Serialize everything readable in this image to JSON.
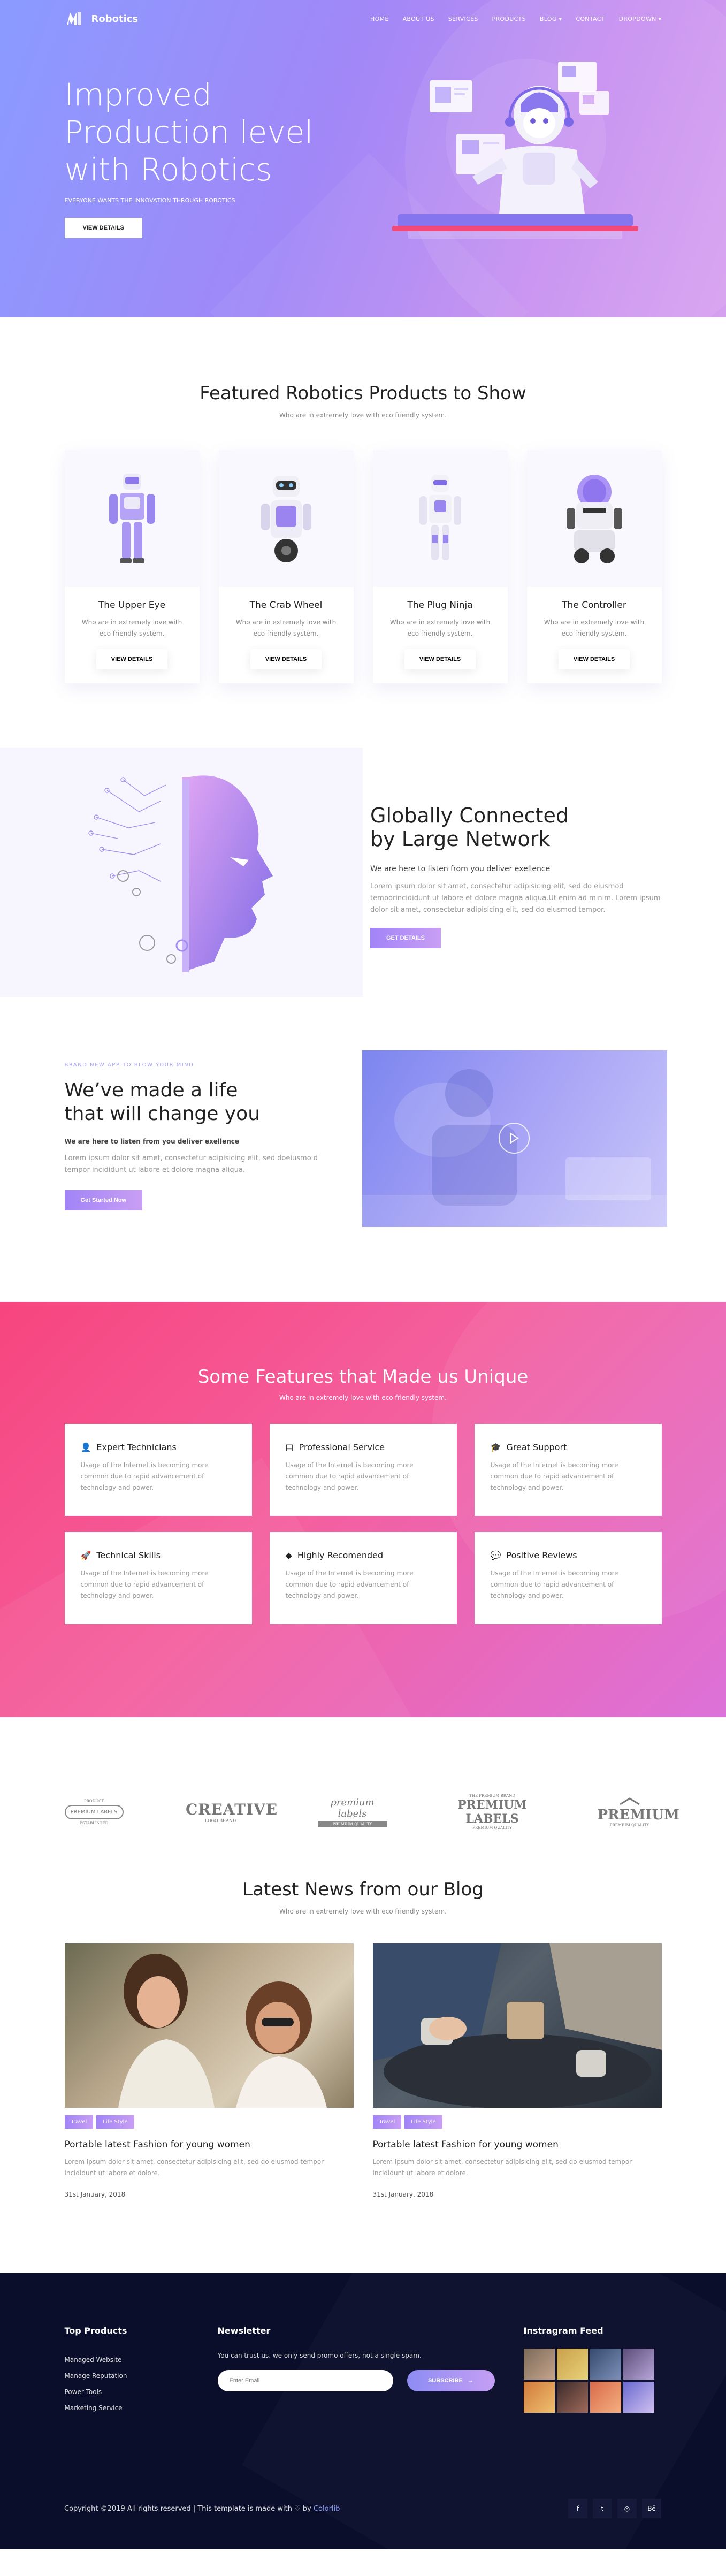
{
  "header": {
    "brand": "Robotics",
    "nav": [
      "HOME",
      "ABOUT US",
      "SERVICES",
      "PRODUCTS",
      "BLOG",
      "CONTACT",
      "DROPDOWN"
    ],
    "nav_dropdown_arrow": "▾"
  },
  "hero": {
    "title": "Improved Production level with Robotics",
    "subtitle": "EVERYONE WANTS THE INNOVATION THROUGH ROBOTICS",
    "button": "VIEW DETAILS"
  },
  "featured": {
    "title": "Featured Robotics Products to Show",
    "subtitle": "Who are in extremely love with eco friendly system.",
    "cards": [
      {
        "title": "The Upper Eye",
        "text": "Who are in extremely love with eco friendly system.",
        "button": "VIEW DETAILS",
        "icon": "humanoid-robot-icon"
      },
      {
        "title": "The Crab Wheel",
        "text": "Who are in extremely love with eco friendly system.",
        "button": "VIEW DETAILS",
        "icon": "wheel-robot-icon"
      },
      {
        "title": "The Plug Ninja",
        "text": "Who are in extremely love with eco friendly system.",
        "button": "VIEW DETAILS",
        "icon": "ninja-robot-icon"
      },
      {
        "title": "The Controller",
        "text": "Who are in extremely love with eco friendly system.",
        "button": "VIEW DETAILS",
        "icon": "dome-robot-icon"
      }
    ]
  },
  "network": {
    "title_line1": "Globally Connected",
    "title_line2": "by Large Network",
    "lead": "We are here to listen from you deliver exellence",
    "body": "Lorem ipsum dolor sit amet, consectetur adipisicing elit, sed do eiusmod temporincididunt ut labore et dolore magna aliqua.Ut enim ad minim. Lorem ipsum dolor sit amet, consectetur adipisicing elit, sed do eiusmod tempor.",
    "button": "GET DETAILS"
  },
  "life": {
    "kicker": "BRAND NEW APP TO BLOW YOUR MIND",
    "title_line1": "We’ve made a life",
    "title_line2": "that will change you",
    "lead": "We are here to listen from you deliver exellence",
    "body": "Lorem ipsum dolor sit amet, consectetur adipisicing elit, sed doeiusmo d tempor incididunt ut labore et dolore magna aliqua.",
    "button": "Get Started Now"
  },
  "features": {
    "title": "Some Features that Made us Unique",
    "subtitle": "Who are in extremely love with eco friendly system.",
    "items": [
      {
        "title": "Expert Technicians",
        "text": "Usage of the Internet is becoming more common due to rapid advancement of technology and power.",
        "icon": "user-icon"
      },
      {
        "title": "Professional Service",
        "text": "Usage of the Internet is becoming more common due to rapid advancement of technology and power.",
        "icon": "certificate-icon"
      },
      {
        "title": "Great Support",
        "text": "Usage of the Internet is becoming more common due to rapid advancement of technology and power.",
        "icon": "graduation-cap-icon"
      },
      {
        "title": "Technical Skills",
        "text": "Usage of the Internet is becoming more common due to rapid advancement of technology and power.",
        "icon": "rocket-icon"
      },
      {
        "title": "Highly Recomended",
        "text": "Usage of the Internet is becoming more common due to rapid advancement of technology and power.",
        "icon": "diamond-icon"
      },
      {
        "title": "Positive Reviews",
        "text": "Usage of the Internet is becoming more common due to rapid advancement of technology and power.",
        "icon": "chat-bubble-icon"
      }
    ]
  },
  "brands": [
    {
      "main": "PREMIUM LABELS",
      "top": "PRODUCT",
      "bottom": "ESTABLISHED"
    },
    {
      "main": "CREATIVE",
      "top": "",
      "bottom": "LOGO BRAND"
    },
    {
      "main": "premium labels",
      "top": "",
      "bottom": "PREMIUM QUALITY"
    },
    {
      "main": "PREMIUM LABELS",
      "top": "THE PREMIUM BRAND",
      "bottom": "PREMIUM QUALITY"
    },
    {
      "main": "PREMIUM",
      "top": "",
      "bottom": "PREMIUM QUALITY"
    }
  ],
  "blog": {
    "title": "Latest News from our Blog",
    "subtitle": "Who are in extremely love with eco friendly system.",
    "posts": [
      {
        "tags": [
          "Travel",
          "Life Style"
        ],
        "title": "Portable latest Fashion for young women",
        "text": "Lorem ipsum dolor sit amet, consectetur adipisicing elit, sed do eiusmod tempor incididunt ut labore et dolore.",
        "date": "31st January, 2018"
      },
      {
        "tags": [
          "Travel",
          "Life Style"
        ],
        "title": "Portable latest Fashion for young women",
        "text": "Lorem ipsum dolor sit amet, consectetur adipisicing elit, sed do eiusmod tempor incididunt ut labore et dolore.",
        "date": "31st January, 2018"
      }
    ]
  },
  "footer": {
    "products_title": "Top Products",
    "products": [
      "Managed Website",
      "Manage Reputation",
      "Power Tools",
      "Marketing Service"
    ],
    "newsletter_title": "Newsletter",
    "newsletter_text": "You can trust us. we only send promo offers, not a single spam.",
    "email_placeholder": "Enter Email",
    "subscribe": "SUBSCRIBE",
    "instagram_title": "Instragram Feed",
    "copyright": "Copyright ©2019 All rights reserved | This template is made with ♡ by",
    "copyright_link": "Colorlib",
    "socials": [
      "f",
      "t",
      "◎",
      "Bē"
    ]
  },
  "colors": {
    "accent": "#a184f7",
    "pink": "#f7457e",
    "navy": "#0a0e2a"
  }
}
